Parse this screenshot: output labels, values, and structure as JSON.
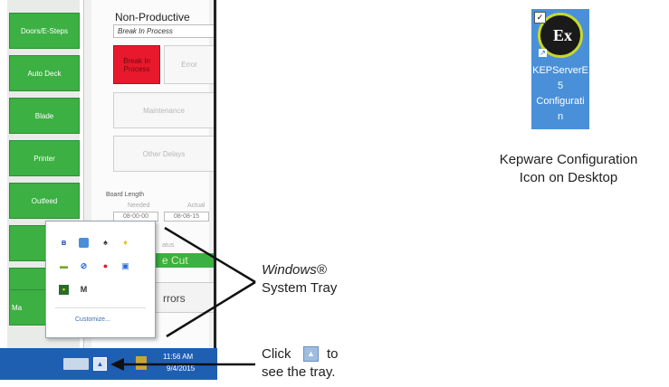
{
  "left_buttons": [
    "Doors/E-Steps",
    "Auto Deck",
    "Blade",
    "Printer",
    "Outfeed"
  ],
  "left_buttons_partial": [
    "Ma"
  ],
  "panel": {
    "title": "Non-Productive",
    "status_value": "Break In Process",
    "buttons": {
      "break_in_process": "Break In Process",
      "error": "Error",
      "maintenance": "Maintenance",
      "other_delays": "Other Delays"
    },
    "board_length_label": "Board Length",
    "needed_label": "Needed",
    "actual_label": "Actual",
    "needed_value": "08-00-00",
    "actual_value": "08-08-15",
    "status_label_partial": "atus",
    "cut_label_partial": "e Cut",
    "errors_label_partial": "rrors"
  },
  "tray": {
    "customize_label": "Customize...",
    "icons": [
      "bluetooth-icon",
      "screen-icon",
      "bell-icon",
      "lightbulb-icon",
      "network-icon",
      "blocked-icon",
      "pie-icon",
      "image-icon",
      "camera-icon",
      "m-icon"
    ]
  },
  "taskbar": {
    "time": "11:56 AM",
    "date": "9/4/2015"
  },
  "desktop_icon": {
    "caption_lines": [
      "KEPServerE",
      "5",
      "Configurati",
      "n"
    ]
  },
  "annotations": {
    "kepware_line1": "Kepware Configuration",
    "kepware_line2": "Icon on Desktop",
    "tray_line1": "Windows®",
    "tray_line2": "System Tray",
    "click_word": "Click",
    "click_to": "to",
    "click_line2": "see the tray."
  },
  "colors": {
    "green": "#3cb043",
    "red": "#e8192c",
    "taskbar": "#1f5fb2",
    "desktop_icon_bg": "#4a90d9"
  }
}
